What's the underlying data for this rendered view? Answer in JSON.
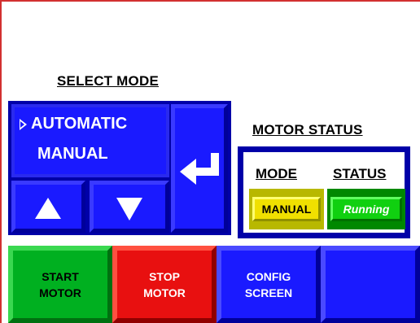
{
  "select_mode": {
    "title": "SELECT MODE",
    "options": [
      "AUTOMATIC",
      "MANUAL"
    ],
    "selected_index": 0,
    "up_icon": "triangle-up-icon",
    "down_icon": "triangle-down-icon",
    "enter_icon": "enter-return-icon"
  },
  "motor_status": {
    "title": "MOTOR STATUS",
    "mode_header": "MODE",
    "status_header": "STATUS",
    "mode_value": "MANUAL",
    "status_value": "Running"
  },
  "buttons": {
    "start": [
      "START",
      "MOTOR"
    ],
    "stop": [
      "STOP",
      "MOTOR"
    ],
    "config": [
      "CONFIG",
      "SCREEN"
    ]
  },
  "colors": {
    "blue": "#1a1aff",
    "dark_blue": "#0000a8",
    "green": "#00b020",
    "red": "#e81010",
    "yellow": "#f0e000",
    "frame_red": "#d23030"
  }
}
